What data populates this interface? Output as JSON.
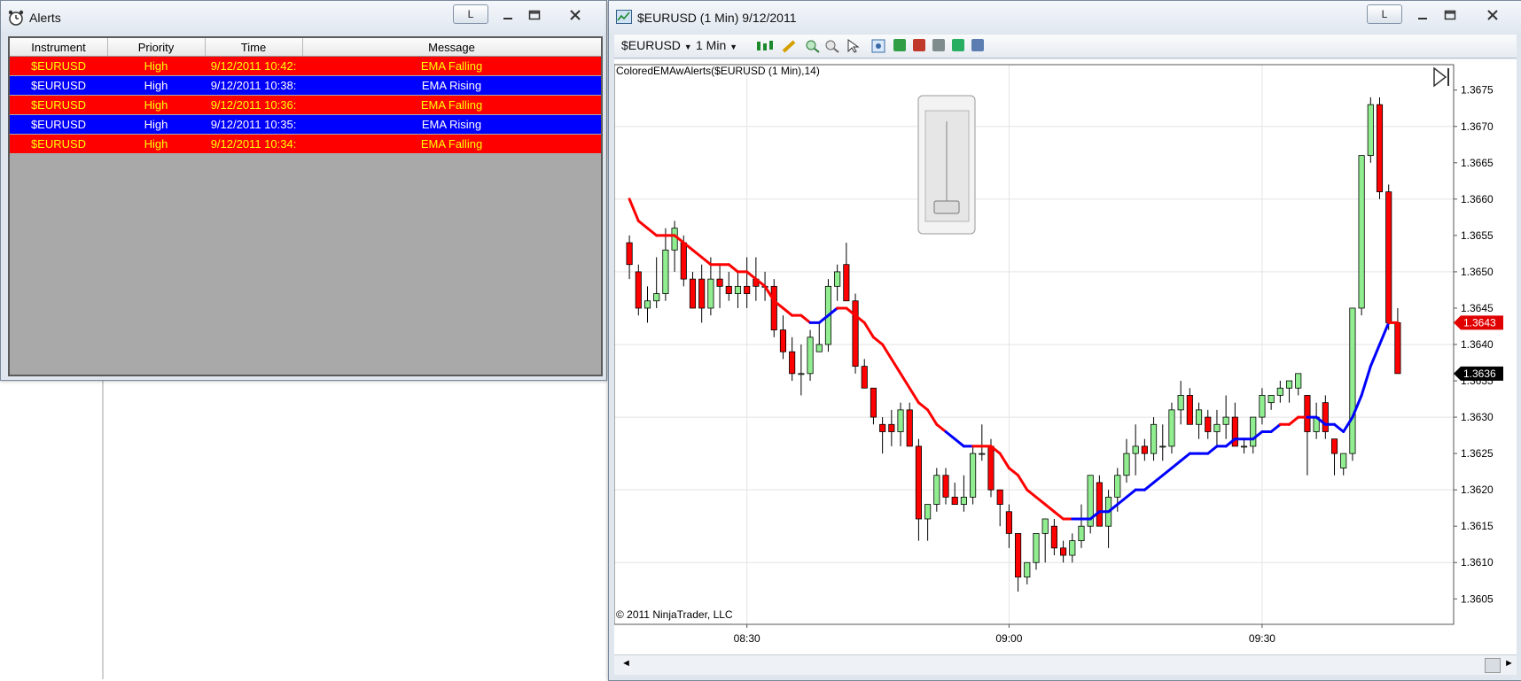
{
  "alerts_window": {
    "title": "Alerts",
    "btn_l": "L",
    "columns": [
      "Instrument",
      "Priority",
      "Time",
      "Message"
    ],
    "rows": [
      {
        "instrument": "$EURUSD",
        "priority": "High",
        "time": "9/12/2011 10:42:",
        "message": "EMA Falling",
        "kind": "falling"
      },
      {
        "instrument": "$EURUSD",
        "priority": "High",
        "time": "9/12/2011 10:38:",
        "message": "EMA Rising",
        "kind": "rising"
      },
      {
        "instrument": "$EURUSD",
        "priority": "High",
        "time": "9/12/2011 10:36:",
        "message": "EMA Falling",
        "kind": "falling"
      },
      {
        "instrument": "$EURUSD",
        "priority": "High",
        "time": "9/12/2011 10:35:",
        "message": "EMA Rising",
        "kind": "rising"
      },
      {
        "instrument": "$EURUSD",
        "priority": "High",
        "time": "9/12/2011 10:34:",
        "message": "EMA Falling",
        "kind": "falling"
      }
    ],
    "colors": {
      "falling_bg": "#ff0000",
      "falling_fg": "#ffff00",
      "rising_bg": "#0000ff",
      "rising_fg": "#ffffff"
    }
  },
  "chart_window": {
    "title": "$EURUSD (1 Min)  9/12/2011",
    "btn_l": "L",
    "toolbar": {
      "instrument": "$EURUSD",
      "interval": "1 Min"
    },
    "indicator_label": "ColoredEMAwAlerts($EURUSD (1 Min),14)",
    "copyright": "© 2011 NinjaTrader, LLC",
    "price_markers": [
      {
        "value": "1.3643",
        "color": "#e00000"
      },
      {
        "value": "1.3636",
        "color": "#000000"
      }
    ]
  },
  "chart_data": {
    "type": "candlestick",
    "y_ticks": [
      "1.3675",
      "1.3670",
      "1.3665",
      "1.3660",
      "1.3655",
      "1.3650",
      "1.3645",
      "1.3640",
      "1.3635",
      "1.3630",
      "1.3625",
      "1.3620",
      "1.3615",
      "1.3610",
      "1.3605"
    ],
    "x_ticks": [
      "08:30",
      "09:00",
      "09:30"
    ],
    "ylim": [
      1.36015,
      1.36785
    ],
    "grid": true,
    "colors": {
      "up": "#90ee90",
      "down": "#ff0000",
      "ema_falling": "#ff0000",
      "ema_rising": "#0000ff"
    },
    "candles": [
      [
        1.3654,
        1.3655,
        1.3649,
        1.3651
      ],
      [
        1.365,
        1.3651,
        1.3644,
        1.3645
      ],
      [
        1.3645,
        1.3648,
        1.3643,
        1.3646
      ],
      [
        1.3646,
        1.3652,
        1.3645,
        1.3647
      ],
      [
        1.3647,
        1.3656,
        1.3646,
        1.3653
      ],
      [
        1.3653,
        1.3657,
        1.365,
        1.3656
      ],
      [
        1.3654,
        1.3655,
        1.3648,
        1.3649
      ],
      [
        1.3649,
        1.365,
        1.3645,
        1.3645
      ],
      [
        1.3649,
        1.3651,
        1.3643,
        1.3645
      ],
      [
        1.3645,
        1.3652,
        1.3644,
        1.3649
      ],
      [
        1.3649,
        1.3651,
        1.3645,
        1.3648
      ],
      [
        1.3648,
        1.365,
        1.3646,
        1.3647
      ],
      [
        1.3647,
        1.365,
        1.3645,
        1.3648
      ],
      [
        1.3648,
        1.3652,
        1.3645,
        1.3647
      ],
      [
        1.3649,
        1.3652,
        1.3646,
        1.3648
      ],
      [
        1.3648,
        1.365,
        1.3646,
        1.3648
      ],
      [
        1.3648,
        1.3649,
        1.3641,
        1.3642
      ],
      [
        1.3642,
        1.3644,
        1.3638,
        1.3639
      ],
      [
        1.3639,
        1.3641,
        1.3635,
        1.3636
      ],
      [
        1.3636,
        1.364,
        1.3633,
        1.3636
      ],
      [
        1.3636,
        1.3642,
        1.3635,
        1.3641
      ],
      [
        1.3639,
        1.3643,
        1.3639,
        1.364
      ],
      [
        1.364,
        1.3649,
        1.3639,
        1.3648
      ],
      [
        1.3648,
        1.3651,
        1.3646,
        1.365
      ],
      [
        1.3651,
        1.3654,
        1.3646,
        1.3646
      ],
      [
        1.3646,
        1.3647,
        1.3636,
        1.3637
      ],
      [
        1.3637,
        1.3638,
        1.3634,
        1.3634
      ],
      [
        1.3634,
        1.3634,
        1.3629,
        1.363
      ],
      [
        1.3629,
        1.363,
        1.3625,
        1.3628
      ],
      [
        1.3629,
        1.3631,
        1.3626,
        1.3628
      ],
      [
        1.3628,
        1.3632,
        1.3626,
        1.3631
      ],
      [
        1.3631,
        1.3632,
        1.3626,
        1.3626
      ],
      [
        1.3626,
        1.3627,
        1.3613,
        1.3616
      ],
      [
        1.3616,
        1.3617,
        1.3613,
        1.3618
      ],
      [
        1.3618,
        1.3623,
        1.3617,
        1.3622
      ],
      [
        1.3622,
        1.3623,
        1.3618,
        1.3619
      ],
      [
        1.3619,
        1.3621,
        1.3618,
        1.3618
      ],
      [
        1.3618,
        1.3622,
        1.3617,
        1.3619
      ],
      [
        1.3619,
        1.3626,
        1.3618,
        1.3625
      ],
      [
        1.3625,
        1.3629,
        1.3624,
        1.3625
      ],
      [
        1.3626,
        1.3627,
        1.3619,
        1.362
      ],
      [
        1.362,
        1.362,
        1.3615,
        1.3618
      ],
      [
        1.3617,
        1.3618,
        1.3612,
        1.3614
      ],
      [
        1.3614,
        1.3614,
        1.3606,
        1.3608
      ],
      [
        1.3608,
        1.361,
        1.3607,
        1.361
      ],
      [
        1.361,
        1.3614,
        1.3609,
        1.3614
      ],
      [
        1.3614,
        1.3616,
        1.361,
        1.3616
      ],
      [
        1.3615,
        1.3616,
        1.3611,
        1.3612
      ],
      [
        1.3612,
        1.3613,
        1.361,
        1.3611
      ],
      [
        1.3611,
        1.3614,
        1.361,
        1.3613
      ],
      [
        1.3613,
        1.3618,
        1.3612,
        1.3615
      ],
      [
        1.3615,
        1.3622,
        1.3614,
        1.3622
      ],
      [
        1.3621,
        1.3622,
        1.3616,
        1.3615
      ],
      [
        1.3615,
        1.362,
        1.3612,
        1.3619
      ],
      [
        1.3619,
        1.3623,
        1.3617,
        1.3622
      ],
      [
        1.3622,
        1.3627,
        1.3621,
        1.3625
      ],
      [
        1.3625,
        1.3629,
        1.3622,
        1.3626
      ],
      [
        1.3626,
        1.3627,
        1.3624,
        1.3625
      ],
      [
        1.3625,
        1.363,
        1.3624,
        1.3629
      ],
      [
        1.3626,
        1.3629,
        1.3624,
        1.3626
      ],
      [
        1.3626,
        1.3632,
        1.3625,
        1.3631
      ],
      [
        1.3631,
        1.3635,
        1.3629,
        1.3633
      ],
      [
        1.3633,
        1.3634,
        1.3629,
        1.3629
      ],
      [
        1.3629,
        1.3632,
        1.3627,
        1.3631
      ],
      [
        1.363,
        1.3631,
        1.3627,
        1.3628
      ],
      [
        1.3628,
        1.3631,
        1.3626,
        1.3629
      ],
      [
        1.3629,
        1.3633,
        1.3627,
        1.363
      ],
      [
        1.363,
        1.3632,
        1.3627,
        1.3626
      ],
      [
        1.3626,
        1.3627,
        1.3625,
        1.3626
      ],
      [
        1.3626,
        1.363,
        1.3625,
        1.363
      ],
      [
        1.363,
        1.3634,
        1.3629,
        1.3633
      ],
      [
        1.3632,
        1.3633,
        1.3631,
        1.3633
      ],
      [
        1.3633,
        1.3635,
        1.3632,
        1.3634
      ],
      [
        1.3634,
        1.3635,
        1.3632,
        1.3635
      ],
      [
        1.3634,
        1.3636,
        1.3633,
        1.3636
      ],
      [
        1.3633,
        1.3633,
        1.3622,
        1.3628
      ],
      [
        1.3628,
        1.3632,
        1.3627,
        1.363
      ],
      [
        1.3632,
        1.3633,
        1.3627,
        1.3628
      ],
      [
        1.3627,
        1.3627,
        1.3622,
        1.3625
      ],
      [
        1.3623,
        1.3624,
        1.3622,
        1.3625
      ],
      [
        1.3625,
        1.3645,
        1.3624,
        1.3645
      ],
      [
        1.3645,
        1.3666,
        1.3644,
        1.3666
      ],
      [
        1.3666,
        1.3674,
        1.3665,
        1.3673
      ],
      [
        1.3673,
        1.3674,
        1.366,
        1.3661
      ],
      [
        1.3661,
        1.3662,
        1.3642,
        1.3643
      ],
      [
        1.3643,
        1.3645,
        1.3636,
        1.3636
      ]
    ],
    "ema": [
      1.366,
      1.3657,
      1.3656,
      1.3655,
      1.3655,
      1.3655,
      1.3654,
      1.3653,
      1.3652,
      1.3651,
      1.3651,
      1.3651,
      1.365,
      1.365,
      1.3649,
      1.3648,
      1.3646,
      1.3645,
      1.3644,
      1.3644,
      1.3643,
      1.3643,
      1.3644,
      1.3645,
      1.3645,
      1.3644,
      1.3643,
      1.3641,
      1.364,
      1.3638,
      1.3636,
      1.3634,
      1.3632,
      1.3631,
      1.3629,
      1.3628,
      1.3627,
      1.3626,
      1.3626,
      1.3626,
      1.3626,
      1.3625,
      1.3623,
      1.3622,
      1.362,
      1.3619,
      1.3618,
      1.3617,
      1.3616,
      1.3616,
      1.3616,
      1.3616,
      1.3617,
      1.3617,
      1.3618,
      1.3619,
      1.362,
      1.362,
      1.3621,
      1.3622,
      1.3623,
      1.3624,
      1.3625,
      1.3625,
      1.3625,
      1.3626,
      1.3626,
      1.3627,
      1.3627,
      1.3627,
      1.3628,
      1.3628,
      1.3629,
      1.3629,
      1.363,
      1.363,
      1.363,
      1.3629,
      1.3629,
      1.3628,
      1.363,
      1.3633,
      1.3637,
      1.364,
      1.3643,
      1.3643
    ],
    "ema_direction": [
      "f",
      "f",
      "f",
      "f",
      "f",
      "f",
      "f",
      "f",
      "f",
      "f",
      "f",
      "f",
      "f",
      "f",
      "f",
      "f",
      "f",
      "f",
      "f",
      "f",
      "f",
      "r",
      "r",
      "r",
      "f",
      "f",
      "f",
      "f",
      "f",
      "f",
      "f",
      "f",
      "f",
      "f",
      "f",
      "f",
      "r",
      "r",
      "r",
      "f",
      "f",
      "f",
      "f",
      "f",
      "f",
      "f",
      "f",
      "f",
      "f",
      "f",
      "r",
      "r",
      "r",
      "r",
      "r",
      "r",
      "r",
      "r",
      "r",
      "r",
      "r",
      "r",
      "r",
      "r",
      "r",
      "r",
      "r",
      "r",
      "r",
      "r",
      "r",
      "r",
      "r",
      "f",
      "f",
      "f",
      "r",
      "r",
      "r",
      "r",
      "r",
      "r",
      "r",
      "r",
      "r",
      "f",
      "f"
    ]
  }
}
